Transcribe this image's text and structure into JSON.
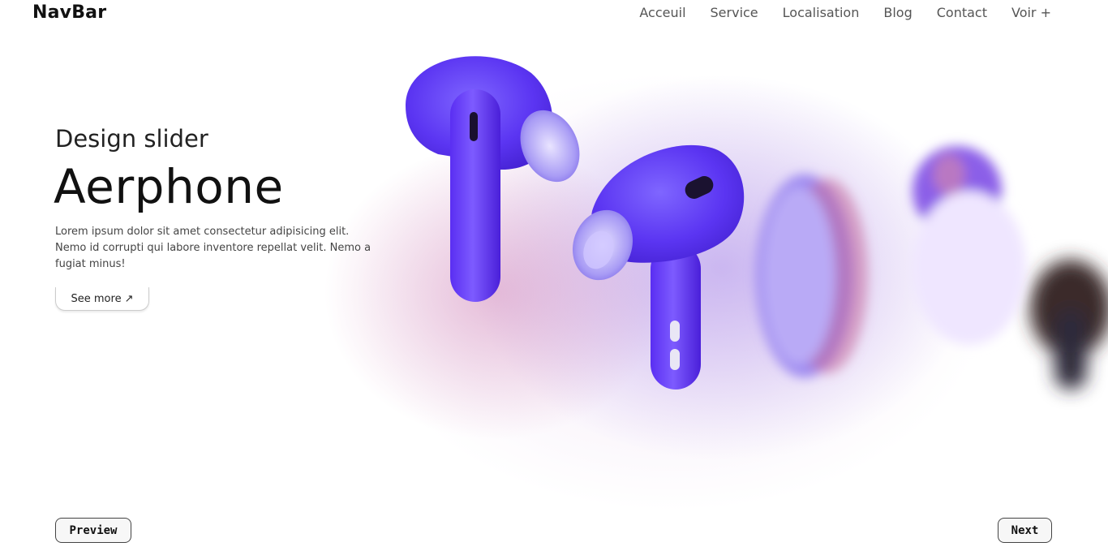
{
  "brand": {
    "logo": "NavBar"
  },
  "nav": {
    "items": [
      {
        "label": "Acceuil"
      },
      {
        "label": "Service"
      },
      {
        "label": "Localisation"
      },
      {
        "label": "Blog"
      },
      {
        "label": "Contact"
      },
      {
        "label": "Voir +"
      }
    ]
  },
  "hero": {
    "subtitle": "Design slider",
    "title": "Aerphone",
    "description": "Lorem ipsum dolor sit amet consectetur adipisicing elit. Nemo id corrupti qui labore inventore repellat velit. Nemo a fugiat minus!",
    "cta_label": "See more",
    "cta_icon": "↗"
  },
  "controls": {
    "prev_label": "Preview",
    "next_label": "Next"
  },
  "colors": {
    "accent": "#5b2df5",
    "accent_light": "#8d7cf5",
    "glow_pink": "#cd78af",
    "glow_violet": "#a88ceb"
  },
  "icons": {
    "cta": "arrow-up-right-icon"
  }
}
